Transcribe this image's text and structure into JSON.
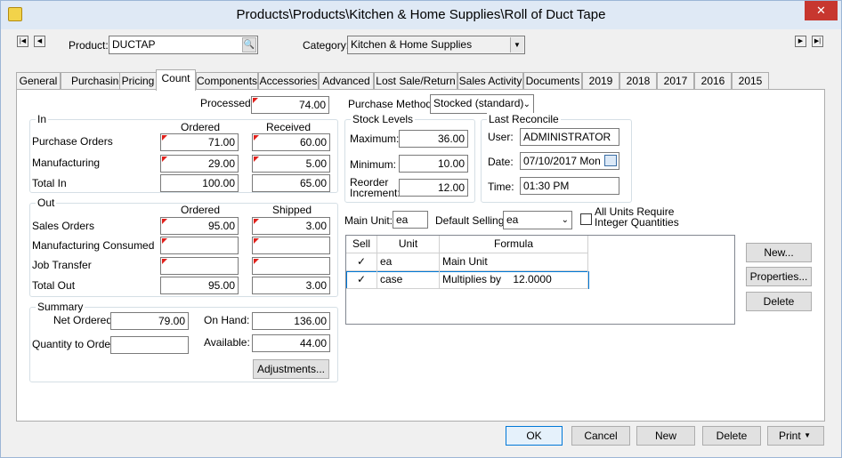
{
  "window": {
    "title": "Products\\Products\\Kitchen & Home Supplies\\Roll of Duct Tape",
    "close_glyph": "✕"
  },
  "header": {
    "product_label": "Product:",
    "product_value": "DUCTAP",
    "category_label": "Category:",
    "category_value": "Kitchen & Home Supplies"
  },
  "tabs": [
    "General",
    "Purchasing",
    "Pricing",
    "Count",
    "Components",
    "Accessories",
    "Advanced",
    "Lost Sale/Return",
    "Sales Activity",
    "Documents",
    "2019",
    "2018",
    "2017",
    "2016",
    "2015"
  ],
  "active_tab": "Count",
  "count": {
    "processed_label": "Processed:",
    "processed_value": "74.00",
    "in": {
      "title": "In",
      "col_ordered": "Ordered",
      "col_received": "Received",
      "rows": [
        {
          "label": "Purchase Orders",
          "ordered": "71.00",
          "received": "60.00"
        },
        {
          "label": "Manufacturing",
          "ordered": "29.00",
          "received": "5.00"
        },
        {
          "label": "Total In",
          "ordered": "100.00",
          "received": "65.00"
        }
      ]
    },
    "out": {
      "title": "Out",
      "col_ordered": "Ordered",
      "col_shipped": "Shipped",
      "rows": [
        {
          "label": "Sales Orders",
          "ordered": "95.00",
          "shipped": "3.00"
        },
        {
          "label": "Manufacturing Consumed",
          "ordered": "",
          "shipped": ""
        },
        {
          "label": "Job Transfer",
          "ordered": "",
          "shipped": ""
        },
        {
          "label": "Total Out",
          "ordered": "95.00",
          "shipped": "3.00"
        }
      ]
    },
    "summary": {
      "title": "Summary",
      "net_ordered_label": "Net Ordered:",
      "net_ordered_value": "79.00",
      "on_hand_label": "On Hand:",
      "on_hand_value": "136.00",
      "qty_to_order_label": "Quantity to Order:",
      "qty_to_order_value": "",
      "available_label": "Available:",
      "available_value": "44.00",
      "adjustments_label": "Adjustments..."
    },
    "purchase_method_label": "Purchase Method:",
    "purchase_method_value": "Stocked (standard)",
    "stock_levels": {
      "title": "Stock Levels",
      "maximum_label": "Maximum:",
      "maximum_value": "36.00",
      "minimum_label": "Minimum:",
      "minimum_value": "10.00",
      "reorder_label_1": "Reorder",
      "reorder_label_2": "Increment:",
      "reorder_value": "12.00"
    },
    "last_reconcile": {
      "title": "Last Reconcile",
      "user_label": "User:",
      "user_value": "ADMINISTRATOR",
      "date_label": "Date:",
      "date_value": "07/10/2017 Mon",
      "time_label": "Time:",
      "time_value": "01:30 PM"
    },
    "units": {
      "main_unit_label": "Main Unit:",
      "main_unit_value": "ea",
      "default_selling_label": "Default Selling:",
      "default_selling_value": "ea",
      "all_units_label_1": "All Units Require",
      "all_units_label_2": "Integer Quantities",
      "grid_headers": {
        "sell": "Sell",
        "unit": "Unit",
        "formula": "Formula"
      },
      "grid_rows": [
        {
          "sell": "✓",
          "unit": "ea",
          "formula": "Main Unit"
        },
        {
          "sell": "✓",
          "unit": "case",
          "formula": "Multiplies by    12.0000"
        }
      ],
      "new_label": "New...",
      "properties_label": "Properties...",
      "delete_label": "Delete"
    }
  },
  "footer": {
    "ok": "OK",
    "cancel": "Cancel",
    "new": "New",
    "delete": "Delete",
    "print": "Print"
  }
}
